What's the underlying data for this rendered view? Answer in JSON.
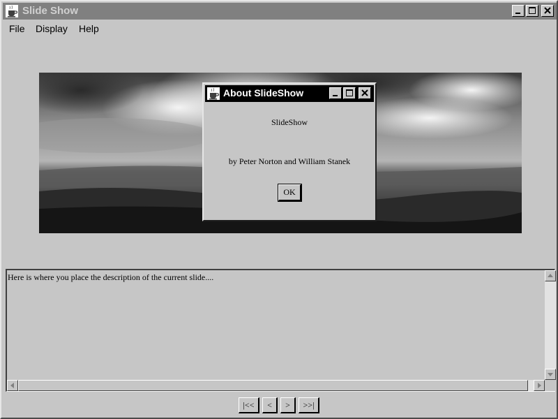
{
  "window": {
    "title": "Slide Show"
  },
  "menu": {
    "items": [
      {
        "label": "File"
      },
      {
        "label": "Display"
      },
      {
        "label": "Help"
      }
    ]
  },
  "description": {
    "text": "Here is where you place the description of the current slide...."
  },
  "navigation": {
    "first_label": "|<<",
    "prev_label": "<",
    "next_label": ">",
    "last_label": ">>|"
  },
  "about_dialog": {
    "title": "About SlideShow",
    "app_name": "SlideShow",
    "authors": "by Peter Norton and William Stanek",
    "ok_label": "OK"
  },
  "icons": {
    "app": "java-coffee-cup-icon",
    "minimize": "minimize-icon",
    "maximize": "maximize-icon",
    "close": "close-icon"
  },
  "colors": {
    "window_bg": "#c6c6c6",
    "inactive_titlebar": "#808080",
    "active_titlebar": "#000000"
  }
}
